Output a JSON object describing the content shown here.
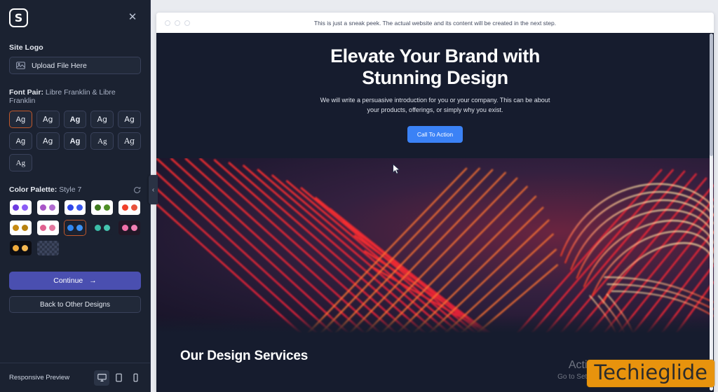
{
  "sidebar": {
    "logo_letter": "S",
    "close_label": "✕",
    "site_logo": {
      "label": "Site Logo",
      "upload_text": "Upload File Here",
      "icon": "image-icon"
    },
    "font_pair": {
      "label": "Font Pair:",
      "value": "Libre Franklin & Libre Franklin",
      "chips": [
        {
          "text": "Ag",
          "style": "f1",
          "selected": true
        },
        {
          "text": "Ag",
          "style": "f2",
          "selected": false
        },
        {
          "text": "Ag",
          "style": "f3",
          "selected": false
        },
        {
          "text": "Ag",
          "style": "f2",
          "selected": false
        },
        {
          "text": "Ag",
          "style": "f2",
          "selected": false
        },
        {
          "text": "Ag",
          "style": "f1",
          "selected": false
        },
        {
          "text": "Ag",
          "style": "f2",
          "selected": false
        },
        {
          "text": "Ag",
          "style": "f3",
          "selected": false
        },
        {
          "text": "Ag",
          "style": "f4",
          "selected": false
        },
        {
          "text": "Ag",
          "style": "f5",
          "selected": false
        },
        {
          "text": "Ag",
          "style": "f4",
          "selected": false
        }
      ]
    },
    "color_palette": {
      "label": "Color Palette:",
      "value": "Style 7",
      "refresh_icon": "refresh-icon",
      "swatches": [
        {
          "bg": "#ffffff",
          "d1": "#6c3ce0",
          "d2": "#8b5cf6",
          "selected": false
        },
        {
          "bg": "#ffffff",
          "d1": "#a855c7",
          "d2": "#b06ad0",
          "selected": false
        },
        {
          "bg": "#ffffff",
          "d1": "#2d46e8",
          "d2": "#3b59f0",
          "selected": false
        },
        {
          "bg": "#ffffff",
          "d1": "#3f7a1e",
          "d2": "#4e8f26",
          "selected": false
        },
        {
          "bg": "#ffffff",
          "d1": "#f0402a",
          "d2": "#e8533c",
          "selected": false
        },
        {
          "bg": "#ffffff",
          "d1": "#c68a12",
          "d2": "#b8820f",
          "selected": false
        },
        {
          "bg": "#ffffff",
          "d1": "#e0608f",
          "d2": "#e3779e",
          "selected": false
        },
        {
          "bg": "#1b2231",
          "d1": "#2f86f0",
          "d2": "#3b92f5",
          "selected": true
        },
        {
          "bg": "#1b2231",
          "d1": "#3bbda8",
          "d2": "#45c5b0",
          "selected": false
        },
        {
          "bg": "#221726",
          "d1": "#f070a8",
          "d2": "#f27fb2",
          "selected": false
        },
        {
          "bg": "#0d0d12",
          "d1": "#f0ab3c",
          "d2": "#f5b852",
          "selected": false
        },
        {
          "bg": "checker",
          "d1": "",
          "d2": "",
          "selected": false
        }
      ]
    },
    "continue_label": "Continue",
    "continue_arrow": "→",
    "back_label": "Back to Other Designs",
    "footer": {
      "label": "Responsive Preview",
      "devices": [
        {
          "name": "desktop-icon",
          "selected": true
        },
        {
          "name": "tablet-icon",
          "selected": false
        },
        {
          "name": "mobile-icon",
          "selected": false
        }
      ]
    },
    "collapse_icon": "‹"
  },
  "preview": {
    "chrome_note": "This is just a sneak peek. The actual website and its content will be created in the next step.",
    "hero": {
      "headline": "Elevate Your Brand with Stunning Design",
      "subtext": "We will write a persuasive introduction for you or your company. This can be about your products, offerings, or simply why you exist.",
      "cta_label": "Call To Action",
      "cta_color": "#3b82f6"
    },
    "services_title": "Our Design Services"
  },
  "overlay": {
    "activate_title": "Activate Windows",
    "activate_sub": "Go to Settings to activate Windows.",
    "watermark": "Techieglide",
    "watermark_color": "#e8930d"
  }
}
